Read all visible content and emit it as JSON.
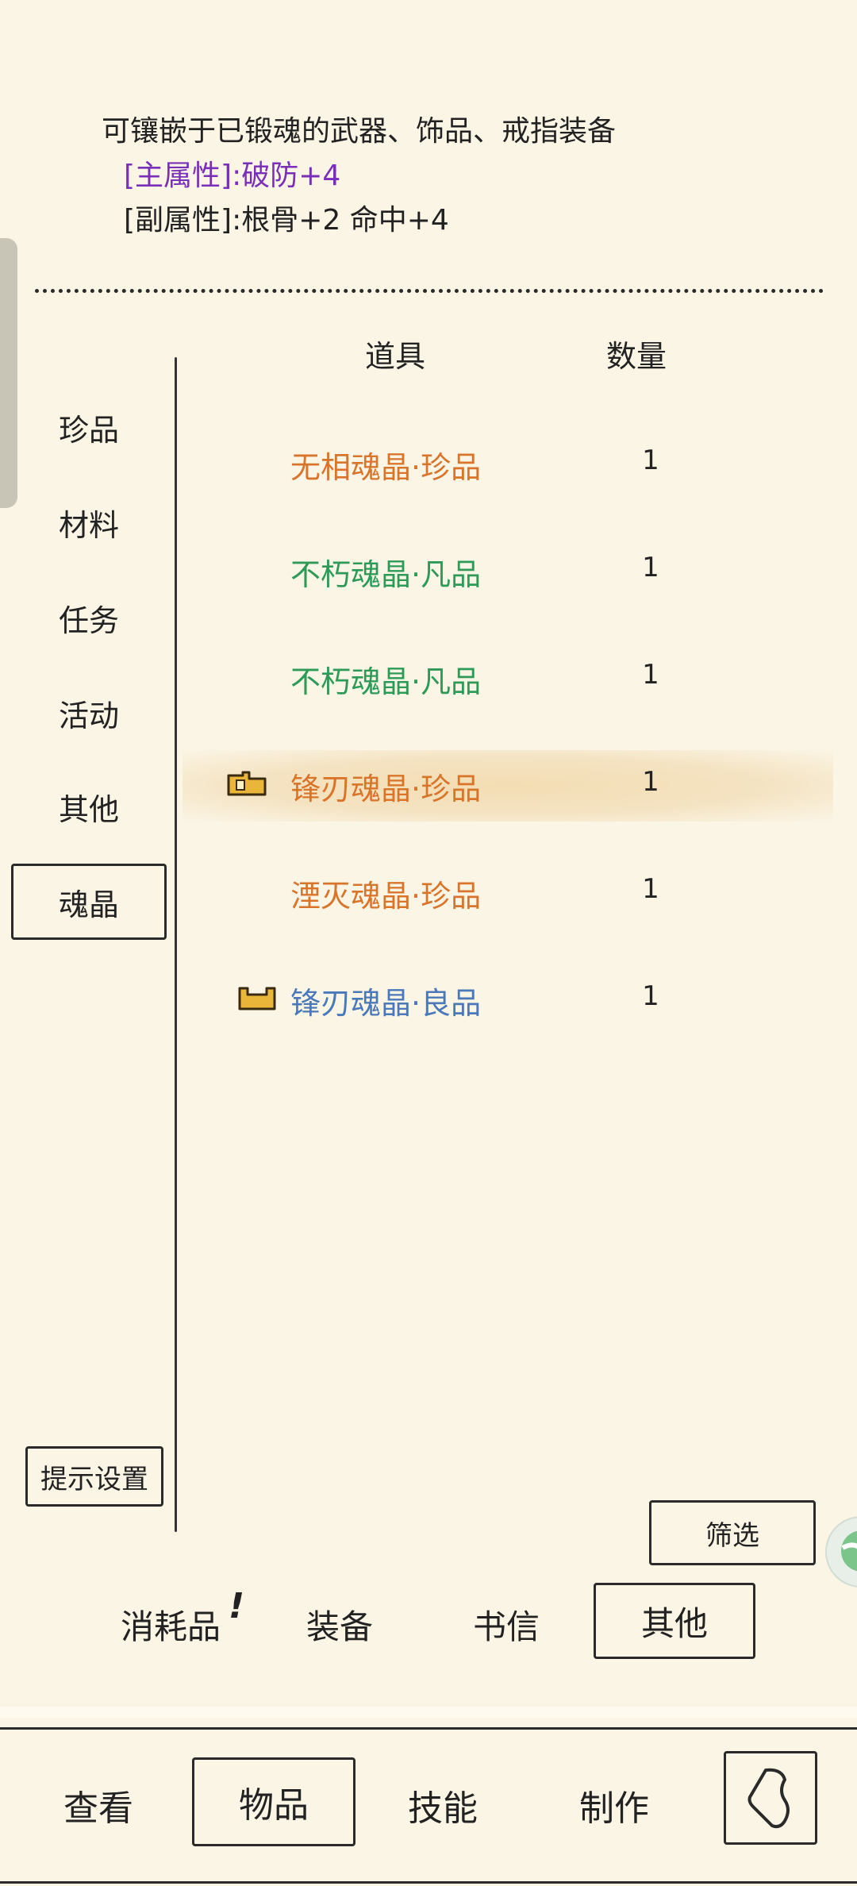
{
  "description": {
    "line1": "可镶嵌于已锻魂的武器、饰品、戒指装备",
    "main_attr": "[主属性]:破防+4",
    "sub_attr": "[副属性]:根骨+2 命中+4"
  },
  "columns": {
    "item": "道具",
    "qty": "数量"
  },
  "categories": [
    {
      "label": "珍品"
    },
    {
      "label": "材料"
    },
    {
      "label": "任务"
    },
    {
      "label": "活动"
    },
    {
      "label": "其他"
    },
    {
      "label": "魂晶"
    }
  ],
  "active_category": "魂晶",
  "items": [
    {
      "name": "无相魂晶·珍品",
      "qty": "1",
      "color": "#d8752a",
      "icon": ""
    },
    {
      "name": "不朽魂晶·凡品",
      "qty": "1",
      "color": "#2e9a58",
      "icon": ""
    },
    {
      "name": "不朽魂晶·凡品",
      "qty": "1",
      "color": "#2e9a58",
      "icon": ""
    },
    {
      "name": "锋刃魂晶·珍品",
      "qty": "1",
      "color": "#d8752a",
      "icon": "equipped-crystal-icon"
    },
    {
      "name": "湮灭魂晶·珍品",
      "qty": "1",
      "color": "#d8752a",
      "icon": ""
    },
    {
      "name": "锋刃魂晶·良品",
      "qty": "1",
      "color": "#4a78b8",
      "icon": "crystal-slot-icon"
    }
  ],
  "hint_settings": "提示设置",
  "filter": "筛选",
  "bottom_tabs": [
    {
      "label": "消耗品",
      "badge": "!"
    },
    {
      "label": "装备"
    },
    {
      "label": "书信"
    },
    {
      "label": "其他"
    }
  ],
  "nav": [
    {
      "label": "查看"
    },
    {
      "label": "物品"
    },
    {
      "label": "技能"
    },
    {
      "label": "制作"
    }
  ],
  "back_icon": "back-arrow-icon"
}
